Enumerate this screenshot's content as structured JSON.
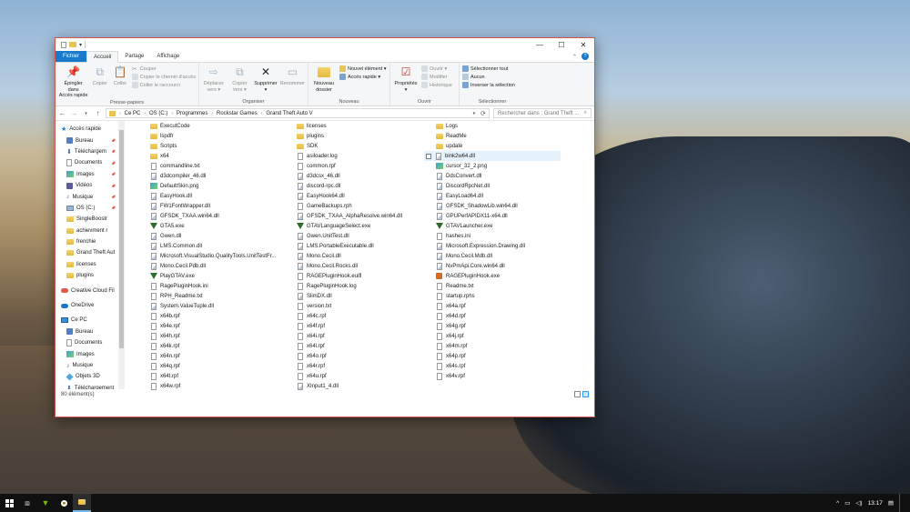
{
  "window": {
    "ribbon_tabs": [
      "Fichier",
      "Accueil",
      "Partage",
      "Affichage"
    ],
    "controls": {
      "minimize": "—",
      "maximize": "☐",
      "close": "✕"
    }
  },
  "ribbon": {
    "presse_papiers": {
      "label": "Presse-papiers",
      "pin": "Épingler dans\nAccès rapide",
      "copy": "Copier",
      "paste": "Coller",
      "cut": "Couper",
      "copy_path": "Copier le chemin d'accès",
      "paste_shortcut": "Coller le raccourci"
    },
    "organiser": {
      "label": "Organiser",
      "move": "Déplacer\nvers ▾",
      "copy_to": "Copier\nvers ▾",
      "delete": "Supprimer\n▾",
      "rename": "Renommer"
    },
    "nouveau": {
      "label": "Nouveau",
      "new_folder": "Nouveau\ndossier",
      "new_item": "Nouvel élément ▾",
      "quick_access": "Accès rapide ▾"
    },
    "ouvrir": {
      "label": "Ouvrir",
      "properties": "Propriétés\n▾",
      "open": "Ouvrir ▾",
      "edit": "Modifier",
      "history": "Historique"
    },
    "selectionner": {
      "label": "Sélectionner",
      "select_all": "Sélectionner tout",
      "select_none": "Aucun",
      "invert": "Inverser la sélection"
    }
  },
  "address": {
    "crumbs": [
      "Ce PC",
      "OS (C:)",
      "Programmes",
      "Rockstar Games",
      "Grand Theft Auto V"
    ],
    "search_placeholder": "Rechercher dans : Grand Theft ..."
  },
  "nav": [
    {
      "label": "Accès rapide",
      "icon": "star-icon",
      "pin": false,
      "header": true
    },
    {
      "label": "Bureau",
      "icon": "desktop-icon",
      "pin": true
    },
    {
      "label": "Téléchargem",
      "icon": "download-icon",
      "pin": true
    },
    {
      "label": "Documents",
      "icon": "document-icon",
      "pin": true
    },
    {
      "label": "Images",
      "icon": "image-icon",
      "pin": true
    },
    {
      "label": "Vidéos",
      "icon": "video-icon",
      "pin": true
    },
    {
      "label": "Musique",
      "icon": "music-icon",
      "pin": true
    },
    {
      "label": "OS (C:)",
      "icon": "drive-icon",
      "pin": true
    },
    {
      "label": "SingleBoostr",
      "icon": "folder-icon",
      "pin": false
    },
    {
      "label": "achievment r",
      "icon": "folder-icon",
      "pin": false
    },
    {
      "label": "frenchie",
      "icon": "folder-icon",
      "pin": false
    },
    {
      "label": "Grand Theft Aut",
      "icon": "folder-icon",
      "pin": false
    },
    {
      "label": "licenses",
      "icon": "folder-icon",
      "pin": false
    },
    {
      "label": "plugins",
      "icon": "folder-icon",
      "pin": false
    },
    {
      "label": "Creative Cloud Fil",
      "icon": "creative-cloud-icon",
      "pin": false,
      "gap": true
    },
    {
      "label": "OneDrive",
      "icon": "onedrive-icon",
      "pin": false,
      "gap": true
    },
    {
      "label": "Ce PC",
      "icon": "pc-icon",
      "pin": false,
      "gap": true
    },
    {
      "label": "Bureau",
      "icon": "desktop-icon",
      "pin": false
    },
    {
      "label": "Documents",
      "icon": "document-icon",
      "pin": false
    },
    {
      "label": "Images",
      "icon": "image-icon",
      "pin": false
    },
    {
      "label": "Musique",
      "icon": "music-icon",
      "pin": false
    },
    {
      "label": "Objets 3D",
      "icon": "cube-icon",
      "pin": false
    },
    {
      "label": "Téléchargement",
      "icon": "download-icon",
      "pin": false
    }
  ],
  "files": {
    "col1": [
      {
        "name": "ExecutCode",
        "type": "folder"
      },
      {
        "name": "lspdfr",
        "type": "folder"
      },
      {
        "name": "Scripts",
        "type": "folder"
      },
      {
        "name": "x64",
        "type": "folder"
      },
      {
        "name": "commandline.txt",
        "type": "file"
      },
      {
        "name": "d3dcompiler_46.dll",
        "type": "dll"
      },
      {
        "name": "DefaultSkin.png",
        "type": "img"
      },
      {
        "name": "EasyHook.dll",
        "type": "dll"
      },
      {
        "name": "FW1FontWrapper.dll",
        "type": "dll"
      },
      {
        "name": "GFSDK_TXAA.win64.dll",
        "type": "dll"
      },
      {
        "name": "GTA5.exe",
        "type": "gta"
      },
      {
        "name": "Gwen.dll",
        "type": "dll"
      },
      {
        "name": "LMS.Common.dll",
        "type": "dll"
      },
      {
        "name": "Microsoft.VisualStudio.QualityTools.UnitTestFr...",
        "type": "dll"
      },
      {
        "name": "Mono.Cecil.Pdb.dll",
        "type": "dll"
      },
      {
        "name": "PlayGTAV.exe",
        "type": "gta"
      },
      {
        "name": "RagePluginHook.ini",
        "type": "file"
      },
      {
        "name": "RPH_Readme.txt",
        "type": "file"
      },
      {
        "name": "System.ValueTuple.dll",
        "type": "dll"
      },
      {
        "name": "x64b.rpf",
        "type": "file"
      },
      {
        "name": "x64e.rpf",
        "type": "file"
      },
      {
        "name": "x64h.rpf",
        "type": "file"
      },
      {
        "name": "x64k.rpf",
        "type": "file"
      },
      {
        "name": "x64n.rpf",
        "type": "file"
      },
      {
        "name": "x64q.rpf",
        "type": "file"
      },
      {
        "name": "x64t.rpf",
        "type": "file"
      },
      {
        "name": "x64w.rpf",
        "type": "file"
      }
    ],
    "col2": [
      {
        "name": "licenses",
        "type": "folder"
      },
      {
        "name": "plugins",
        "type": "folder"
      },
      {
        "name": "SDK",
        "type": "folder"
      },
      {
        "name": "asiloader.log",
        "type": "file"
      },
      {
        "name": "common.rpf",
        "type": "file"
      },
      {
        "name": "d3dcsx_46.dll",
        "type": "dll"
      },
      {
        "name": "discord-rpc.dll",
        "type": "dll"
      },
      {
        "name": "EasyHook64.dll",
        "type": "dll"
      },
      {
        "name": "GameBackups.rph",
        "type": "file"
      },
      {
        "name": "GFSDK_TXAA_AlphaResolve.win64.dll",
        "type": "dll"
      },
      {
        "name": "GTAVLanguageSelect.exe",
        "type": "gta"
      },
      {
        "name": "Gwen.UnitTest.dll",
        "type": "dll"
      },
      {
        "name": "LMS.PortableExecutable.dll",
        "type": "dll"
      },
      {
        "name": "Mono.Cecil.dll",
        "type": "dll"
      },
      {
        "name": "Mono.Cecil.Rocks.dll",
        "type": "dll"
      },
      {
        "name": "RAGEPluginHook.euifl",
        "type": "file"
      },
      {
        "name": "RagePluginHook.log",
        "type": "file"
      },
      {
        "name": "SlimDX.dll",
        "type": "dll"
      },
      {
        "name": "version.txt",
        "type": "file"
      },
      {
        "name": "x64c.rpf",
        "type": "file"
      },
      {
        "name": "x64f.rpf",
        "type": "file"
      },
      {
        "name": "x64i.rpf",
        "type": "file"
      },
      {
        "name": "x64l.rpf",
        "type": "file"
      },
      {
        "name": "x64o.rpf",
        "type": "file"
      },
      {
        "name": "x64r.rpf",
        "type": "file"
      },
      {
        "name": "x64u.rpf",
        "type": "file"
      },
      {
        "name": "XInput1_4.dll",
        "type": "dll"
      }
    ],
    "col3": [
      {
        "name": "Logs",
        "type": "folder"
      },
      {
        "name": "ReadMe",
        "type": "folder"
      },
      {
        "name": "update",
        "type": "folder"
      },
      {
        "name": "bink2w64.dll",
        "type": "dll",
        "selected": true
      },
      {
        "name": "cursor_32_2.png",
        "type": "img"
      },
      {
        "name": "DdsConvert.dll",
        "type": "dll"
      },
      {
        "name": "DiscordRpcNet.dll",
        "type": "dll"
      },
      {
        "name": "EasyLoad64.dll",
        "type": "dll"
      },
      {
        "name": "GFSDK_ShadowLib.win64.dll",
        "type": "dll"
      },
      {
        "name": "GPUPerfAPIDX11-x64.dll",
        "type": "dll"
      },
      {
        "name": "GTAVLauncher.exe",
        "type": "gta"
      },
      {
        "name": "hashes.ini",
        "type": "file"
      },
      {
        "name": "Microsoft.Expression.Drawing.dll",
        "type": "dll"
      },
      {
        "name": "Mono.Cecil.Mdb.dll",
        "type": "dll"
      },
      {
        "name": "NvPmApi.Core.win64.dll",
        "type": "dll"
      },
      {
        "name": "RAGEPluginHook.exe",
        "type": "rph"
      },
      {
        "name": "Readme.txt",
        "type": "file"
      },
      {
        "name": "startup.rphs",
        "type": "file"
      },
      {
        "name": "x64a.rpf",
        "type": "file"
      },
      {
        "name": "x64d.rpf",
        "type": "file"
      },
      {
        "name": "x64g.rpf",
        "type": "file"
      },
      {
        "name": "x64j.rpf",
        "type": "file"
      },
      {
        "name": "x64m.rpf",
        "type": "file"
      },
      {
        "name": "x64p.rpf",
        "type": "file"
      },
      {
        "name": "x64s.rpf",
        "type": "file"
      },
      {
        "name": "x64v.rpf",
        "type": "file"
      }
    ]
  },
  "status": {
    "count": "80 élément(s)"
  },
  "taskbar": {
    "time": "13:17"
  }
}
